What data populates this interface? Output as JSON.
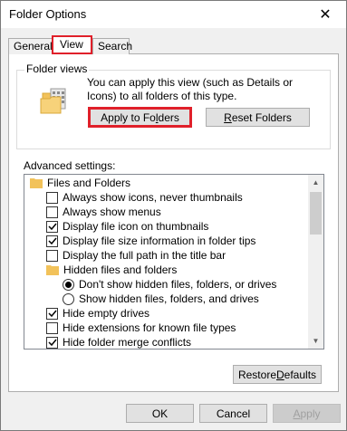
{
  "window": {
    "title": "Folder Options",
    "close_glyph": "✕"
  },
  "tabs": [
    {
      "label": "General",
      "active": false
    },
    {
      "label": "View",
      "active": true
    },
    {
      "label": "Search",
      "active": false
    }
  ],
  "folder_views": {
    "label": "Folder views",
    "description": "You can apply this view (such as Details or Icons) to all folders of this type.",
    "apply_prefix": "Apply to Fo",
    "apply_ul": "l",
    "apply_suffix": "ders",
    "reset_ul": "R",
    "reset_suffix": "eset Folders"
  },
  "advanced": {
    "label": "Advanced settings:",
    "items": [
      {
        "type": "folder",
        "label": "Files and Folders"
      },
      {
        "type": "checkbox",
        "checked": false,
        "label": "Always show icons, never thumbnails"
      },
      {
        "type": "checkbox",
        "checked": false,
        "label": "Always show menus"
      },
      {
        "type": "checkbox",
        "checked": true,
        "label": "Display file icon on thumbnails"
      },
      {
        "type": "checkbox",
        "checked": true,
        "label": "Display file size information in folder tips"
      },
      {
        "type": "checkbox",
        "checked": false,
        "label": "Display the full path in the title bar"
      },
      {
        "type": "folder",
        "label": "Hidden files and folders"
      },
      {
        "type": "radio",
        "checked": true,
        "label": "Don't show hidden files, folders, or drives"
      },
      {
        "type": "radio",
        "checked": false,
        "label": "Show hidden files, folders, and drives"
      },
      {
        "type": "checkbox",
        "checked": true,
        "label": "Hide empty drives"
      },
      {
        "type": "checkbox",
        "checked": false,
        "label": "Hide extensions for known file types"
      },
      {
        "type": "checkbox",
        "checked": true,
        "label": "Hide folder merge conflicts"
      }
    ]
  },
  "restore": {
    "prefix": "Restore ",
    "ul": "D",
    "suffix": "efaults"
  },
  "footer": {
    "ok": "OK",
    "cancel": "Cancel",
    "apply_ul": "A",
    "apply_suffix": "pply"
  },
  "colors": {
    "highlight": "#e0202a",
    "folder": "#f2c25a",
    "disabled_text": "#a0a0a0"
  }
}
